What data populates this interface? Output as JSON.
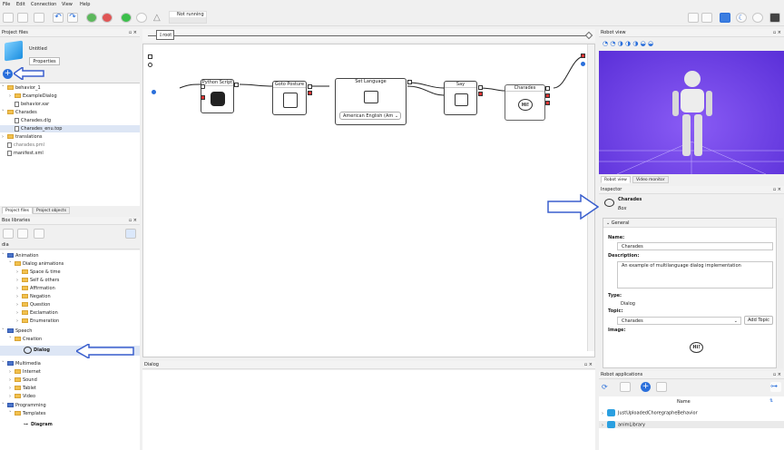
{
  "menu": [
    "File",
    "Edit",
    "Connection",
    "View",
    "Help"
  ],
  "status": "Not running",
  "project_files": {
    "title": "Project files",
    "project_name": "Untitled",
    "properties": "Properties",
    "tree": [
      "behavior_1",
      "ExampleDialog",
      "behavior.xar",
      "Charades",
      "Charades.dlg",
      "Charades_enu.top",
      "translations",
      "charades.pml",
      "manifest.xml"
    ],
    "tabs": [
      "Project files",
      "Project objects"
    ]
  },
  "box_libraries": {
    "title": "Box libraries",
    "filter": "dia",
    "tree": [
      "Animation",
      "Dialog animations",
      "Space & time",
      "Self & others",
      "Affirmation",
      "Negation",
      "Question",
      "Exclamation",
      "Enumeration",
      "Speech",
      "Creation",
      "Dialog",
      "Multimedia",
      "Internet",
      "Sound",
      "Tablet",
      "Video",
      "Programming",
      "Templates",
      "Diagram"
    ]
  },
  "flow": {
    "root": "root",
    "boxes": [
      "Python Script",
      "Goto Posture",
      "Set Language",
      "Say",
      "Charades"
    ],
    "language": "American English (Am"
  },
  "dialog_panel": {
    "title": "Dialog"
  },
  "robot_view": {
    "title": "Robot view",
    "tabs": [
      "Robot view",
      "Video monitor"
    ]
  },
  "inspector": {
    "title": "Inspector",
    "name": "Charades",
    "kind": "Box",
    "section": "General",
    "name_label": "Name:",
    "name_value": "Charades",
    "desc_label": "Description:",
    "desc_value": "An example of multilanguage dialog implementation",
    "type_label": "Type:",
    "type_value": "Dialog",
    "topic_label": "Topic:",
    "topic_value": "Charades",
    "add_topic": "Add Topic",
    "image_label": "Image:",
    "image_text": "Hi!"
  },
  "robot_apps": {
    "title": "Robot applications",
    "column": "Name",
    "items": [
      "JustUploadedChoregrapheBehavior",
      "animLibrary"
    ]
  },
  "colors": {
    "accent": "#2a6fdb",
    "arrow": "#3a5fcd"
  }
}
